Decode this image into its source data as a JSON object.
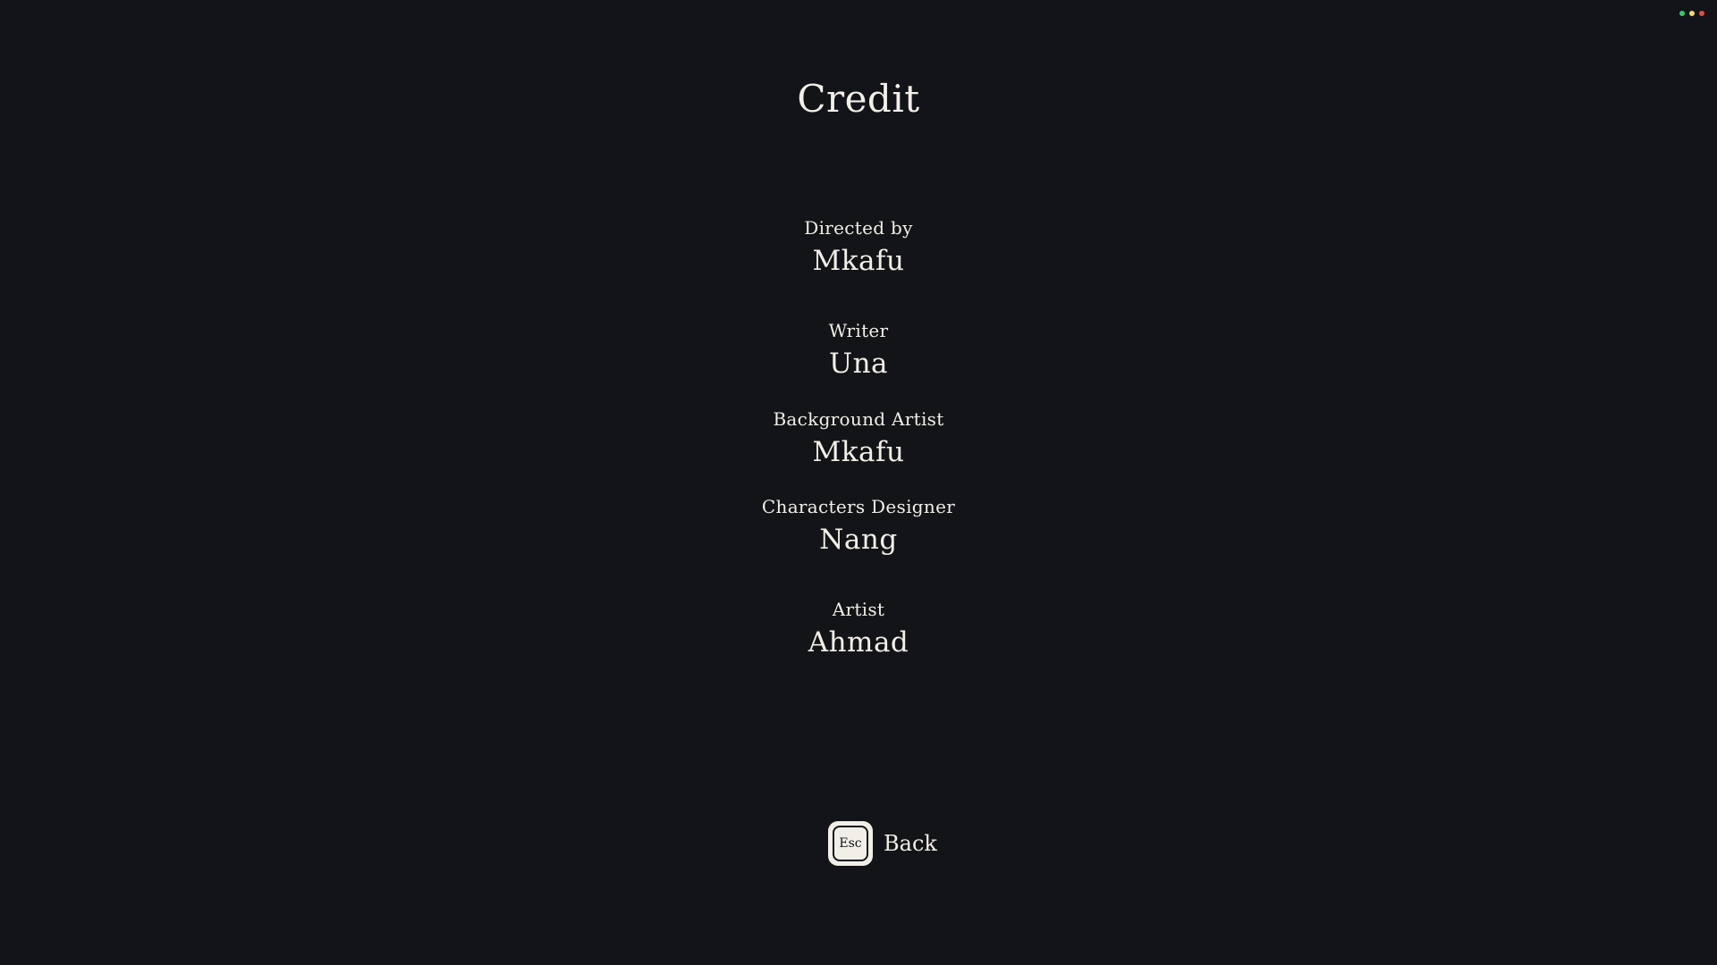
{
  "screen": {
    "title": "Credit"
  },
  "status_dots": [
    {
      "color": "#2ecc71"
    },
    {
      "color": "#f5d76e"
    },
    {
      "color": "#e74c3c"
    }
  ],
  "credits": [
    {
      "role": "Directed by",
      "name": "Mkafu"
    },
    {
      "role": "Writer",
      "name": "Una"
    },
    {
      "role": "Background Artist",
      "name": "Mkafu"
    },
    {
      "role": "Characters Designer",
      "name": "Nang"
    },
    {
      "role": "Artist",
      "name": "Ahmad"
    }
  ],
  "back": {
    "key_label": "Esc",
    "label": "Back"
  }
}
